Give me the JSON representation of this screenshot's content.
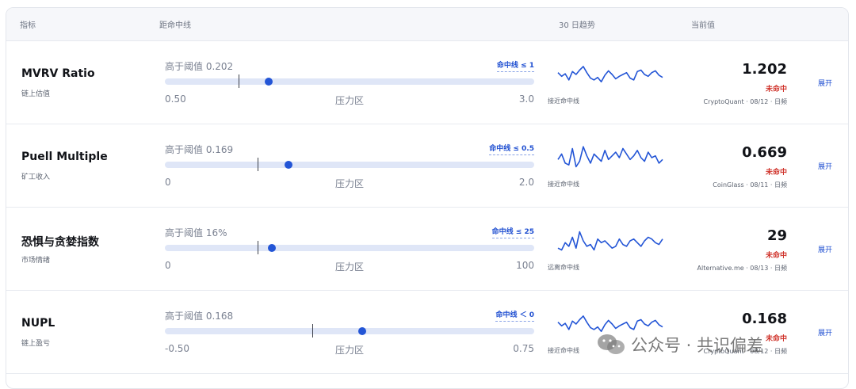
{
  "header": {
    "col_indicator": "指标",
    "col_distance": "距命中线",
    "col_trend": "30 日趋势",
    "col_current": "当前值"
  },
  "rows": [
    {
      "name": "MVRV Ratio",
      "sub": "链上估值",
      "distance_label": "高于阈值 0.202",
      "threshold": "命中线 ≤ 1",
      "axis_min": "0.50",
      "zone": "压力区",
      "axis_max": "3.0",
      "track_min": 0.5,
      "track_max": 3.0,
      "threshold_value": 1.0,
      "current_value": 1.202,
      "trend_caption": "接近命中线",
      "trend": [
        0.55,
        0.45,
        0.52,
        0.35,
        0.58,
        0.5,
        0.62,
        0.72,
        0.55,
        0.4,
        0.35,
        0.42,
        0.3,
        0.48,
        0.6,
        0.5,
        0.38,
        0.45,
        0.5,
        0.55,
        0.4,
        0.35,
        0.58,
        0.62,
        0.5,
        0.45,
        0.55,
        0.6,
        0.48,
        0.42
      ],
      "value": "1.202",
      "status": "未命中",
      "source": "CryptoQuant · 08/12 · 日频",
      "expand": "展开"
    },
    {
      "name": "Puell Multiple",
      "sub": "矿工收入",
      "distance_label": "高于阈值 0.169",
      "threshold": "命中线 ≤ 0.5",
      "axis_min": "0",
      "zone": "压力区",
      "axis_max": "2.0",
      "track_min": 0,
      "track_max": 2.0,
      "threshold_value": 0.5,
      "current_value": 0.669,
      "trend_caption": "接近命中线",
      "trend": [
        0.45,
        0.6,
        0.35,
        0.3,
        0.75,
        0.25,
        0.4,
        0.8,
        0.55,
        0.35,
        0.6,
        0.5,
        0.4,
        0.7,
        0.45,
        0.55,
        0.65,
        0.5,
        0.75,
        0.6,
        0.45,
        0.55,
        0.7,
        0.5,
        0.4,
        0.65,
        0.5,
        0.55,
        0.35,
        0.45
      ],
      "value": "0.669",
      "status": "未命中",
      "source": "CoinGlass · 08/11 · 日频",
      "expand": "展开"
    },
    {
      "name": "恐惧与贪婪指数",
      "sub": "市场情绪",
      "distance_label": "高于阈值 16%",
      "threshold": "命中线 ≤ 25",
      "axis_min": "0",
      "zone": "压力区",
      "axis_max": "100",
      "track_min": 0,
      "track_max": 100,
      "threshold_value": 25,
      "current_value": 29,
      "trend_caption": "远离命中线",
      "trend": [
        0.3,
        0.25,
        0.45,
        0.35,
        0.6,
        0.3,
        0.75,
        0.5,
        0.35,
        0.4,
        0.25,
        0.55,
        0.45,
        0.5,
        0.4,
        0.3,
        0.35,
        0.55,
        0.4,
        0.35,
        0.5,
        0.55,
        0.45,
        0.35,
        0.5,
        0.6,
        0.55,
        0.45,
        0.4,
        0.55
      ],
      "value": "29",
      "status": "未命中",
      "source": "Alternative.me · 08/13 · 日频",
      "expand": "展开"
    },
    {
      "name": "NUPL",
      "sub": "链上盈亏",
      "distance_label": "高于阈值 0.168",
      "threshold": "命中线 ＜ 0",
      "axis_min": "-0.50",
      "zone": "压力区",
      "axis_max": "0.75",
      "track_min": -0.5,
      "track_max": 0.75,
      "threshold_value": 0,
      "current_value": 0.168,
      "trend_caption": "接近命中线",
      "trend": [
        0.55,
        0.45,
        0.52,
        0.35,
        0.58,
        0.5,
        0.62,
        0.72,
        0.55,
        0.4,
        0.35,
        0.42,
        0.3,
        0.48,
        0.6,
        0.5,
        0.38,
        0.45,
        0.5,
        0.55,
        0.4,
        0.35,
        0.58,
        0.62,
        0.5,
        0.45,
        0.55,
        0.6,
        0.48,
        0.42
      ],
      "value": "0.168",
      "status": "未命中",
      "source": "CryptoQuant · 08/12 · 日频",
      "expand": "展开"
    }
  ],
  "watermark": "公众号 · 共识偏差",
  "colors": {
    "accent": "#2355d6",
    "miss": "#d0342c",
    "track": "#dfe6f7"
  }
}
